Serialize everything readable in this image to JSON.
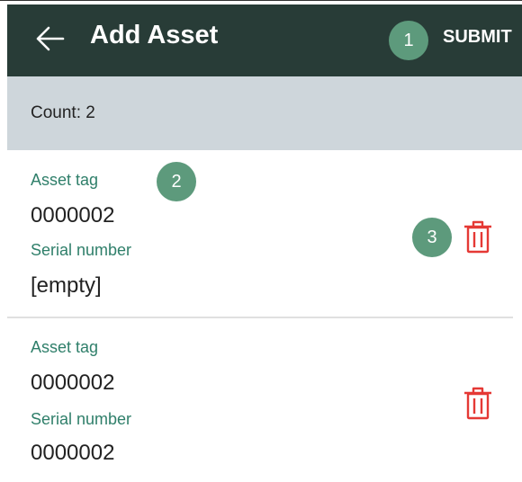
{
  "header": {
    "title": "Add Asset",
    "submit_label": "SUBMIT",
    "badge1": "1"
  },
  "count_text": "Count: 2",
  "annotations": {
    "badge2": "2",
    "badge3": "3"
  },
  "items": [
    {
      "asset_tag_label": "Asset tag",
      "asset_tag_value": "0000002",
      "serial_label": "Serial number",
      "serial_value": "[empty]"
    },
    {
      "asset_tag_label": "Asset tag",
      "asset_tag_value": "0000002",
      "serial_label": "Serial number",
      "serial_value": "0000002"
    }
  ],
  "colors": {
    "appbar": "#283c37",
    "badge": "#5d9a7c",
    "count_bar": "#ced6db",
    "label": "#2f7f6a",
    "delete": "#e53935"
  },
  "icons": {
    "back": "arrow-left-icon",
    "delete": "trash-icon"
  }
}
